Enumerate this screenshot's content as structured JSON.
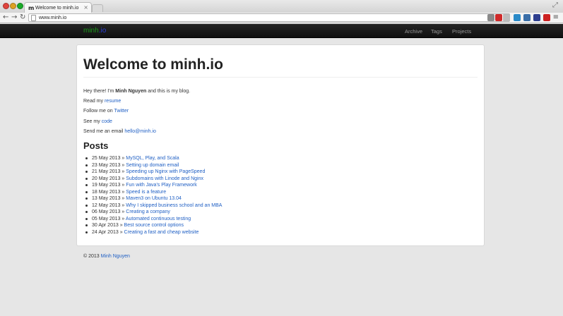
{
  "browser": {
    "tab_title": "Welcome to minh.io",
    "tab_favicon": "m",
    "close_glyph": "×",
    "fullscreen_glyph": "⤢",
    "url": "www.minh.io",
    "back_glyph": "←",
    "forward_glyph": "→",
    "reload_glyph": "↻",
    "menu_glyph": "≡",
    "icons": [
      "page-icon",
      "back-arrow-icon",
      "forward-arrow-icon",
      "reload-icon",
      "fullscreen-icon",
      "menu-icon"
    ],
    "extensions": [
      {
        "name": "extension-gear-icon",
        "color": "#8a8a8a"
      },
      {
        "name": "extension-adblock-icon",
        "color": "#d02a2a"
      },
      {
        "name": "bookmark-star-icon",
        "color": "#bdbdbd"
      },
      {
        "name": "extension-monitor-icon",
        "color": "#2a8ac8"
      },
      {
        "name": "extension-grid-icon",
        "color": "#3a6ea8"
      },
      {
        "name": "extension-blue-icon",
        "color": "#2e3f8f"
      },
      {
        "name": "extension-red-icon",
        "color": "#cc2222"
      }
    ]
  },
  "site": {
    "brand_main": "minh",
    "brand_tld": ".io",
    "nav": [
      "Archive",
      "Tags",
      "Projects"
    ],
    "colors": {
      "brand_green": "#1a9a1a",
      "brand_blue": "#2a3fd8",
      "link": "#1f5fc4",
      "navbar": "#1a1a1a"
    }
  },
  "main": {
    "title": "Welcome to minh.io",
    "intro_prefix": "Hey there! I'm ",
    "intro_name": "Minh Nguyen",
    "intro_suffix": " and this is my blog.",
    "resume_prefix": "Read my ",
    "resume_link": "resume",
    "twitter_prefix": "Follow me on ",
    "twitter_link": "Twitter",
    "code_prefix": "See my ",
    "code_link": "code",
    "email_prefix": "Send me an email ",
    "email_link": "hello@minh.io",
    "posts_heading": "Posts",
    "posts": [
      {
        "date": "25 May 2013 »",
        "title": "MySQL, Play, and Scala"
      },
      {
        "date": "23 May 2013 »",
        "title": "Setting up domain email"
      },
      {
        "date": "21 May 2013 »",
        "title": "Speeding up Nginx with PageSpeed"
      },
      {
        "date": "20 May 2013 »",
        "title": "Subdomains with Linode and Nginx"
      },
      {
        "date": "19 May 2013 »",
        "title": "Fun with Java's Play Framework"
      },
      {
        "date": "18 May 2013 »",
        "title": "Speed is a feature"
      },
      {
        "date": "13 May 2013 »",
        "title": "Maven3 on Ubuntu 13.04"
      },
      {
        "date": "12 May 2013 »",
        "title": "Why I skipped business school and an MBA"
      },
      {
        "date": "06 May 2013 »",
        "title": "Creating a company"
      },
      {
        "date": "05 May 2013 »",
        "title": "Automated continuous testing"
      },
      {
        "date": "30 Apr 2013 »",
        "title": "Best source control options"
      },
      {
        "date": "24 Apr 2013 »",
        "title": "Creating a fast and cheap website"
      }
    ]
  },
  "footer": {
    "copyright": "© 2013 ",
    "author_link": "Minh Nguyen"
  }
}
